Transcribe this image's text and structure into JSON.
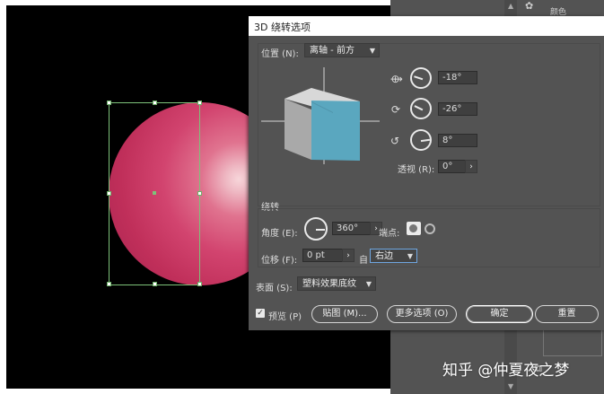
{
  "dialog": {
    "title": "3D 绕转选项",
    "position_label": "位置 (N):",
    "position_value": "离轴 - 前方",
    "x_rotation": "-18°",
    "y_rotation": "-26°",
    "z_rotation": "8°",
    "perspective_label": "透视 (R):",
    "perspective_value": "0°",
    "revolve_section": "绕转",
    "angle_label": "角度 (E):",
    "angle_value": "360°",
    "cap_label": "端点:",
    "offset_label": "位移 (F):",
    "offset_value": "0 pt",
    "from_label": "自",
    "from_value": "右边",
    "surface_label": "表面 (S):",
    "surface_value": "塑料效果底纹",
    "preview_label": "预览 (P)",
    "preview_checked": true,
    "map_button": "贴图 (M)...",
    "more_button": "更多选项 (O)",
    "ok_button": "确定",
    "reset_button": "重置"
  },
  "right_panel": {
    "tab_label": "颜色"
  },
  "watermark": "知乎 @仲夏夜之梦",
  "colors": {
    "sphere": "#c8335f",
    "cube_front": "#5aa7bf",
    "guide": "#7ec27a",
    "dialog_bg": "#535353"
  }
}
